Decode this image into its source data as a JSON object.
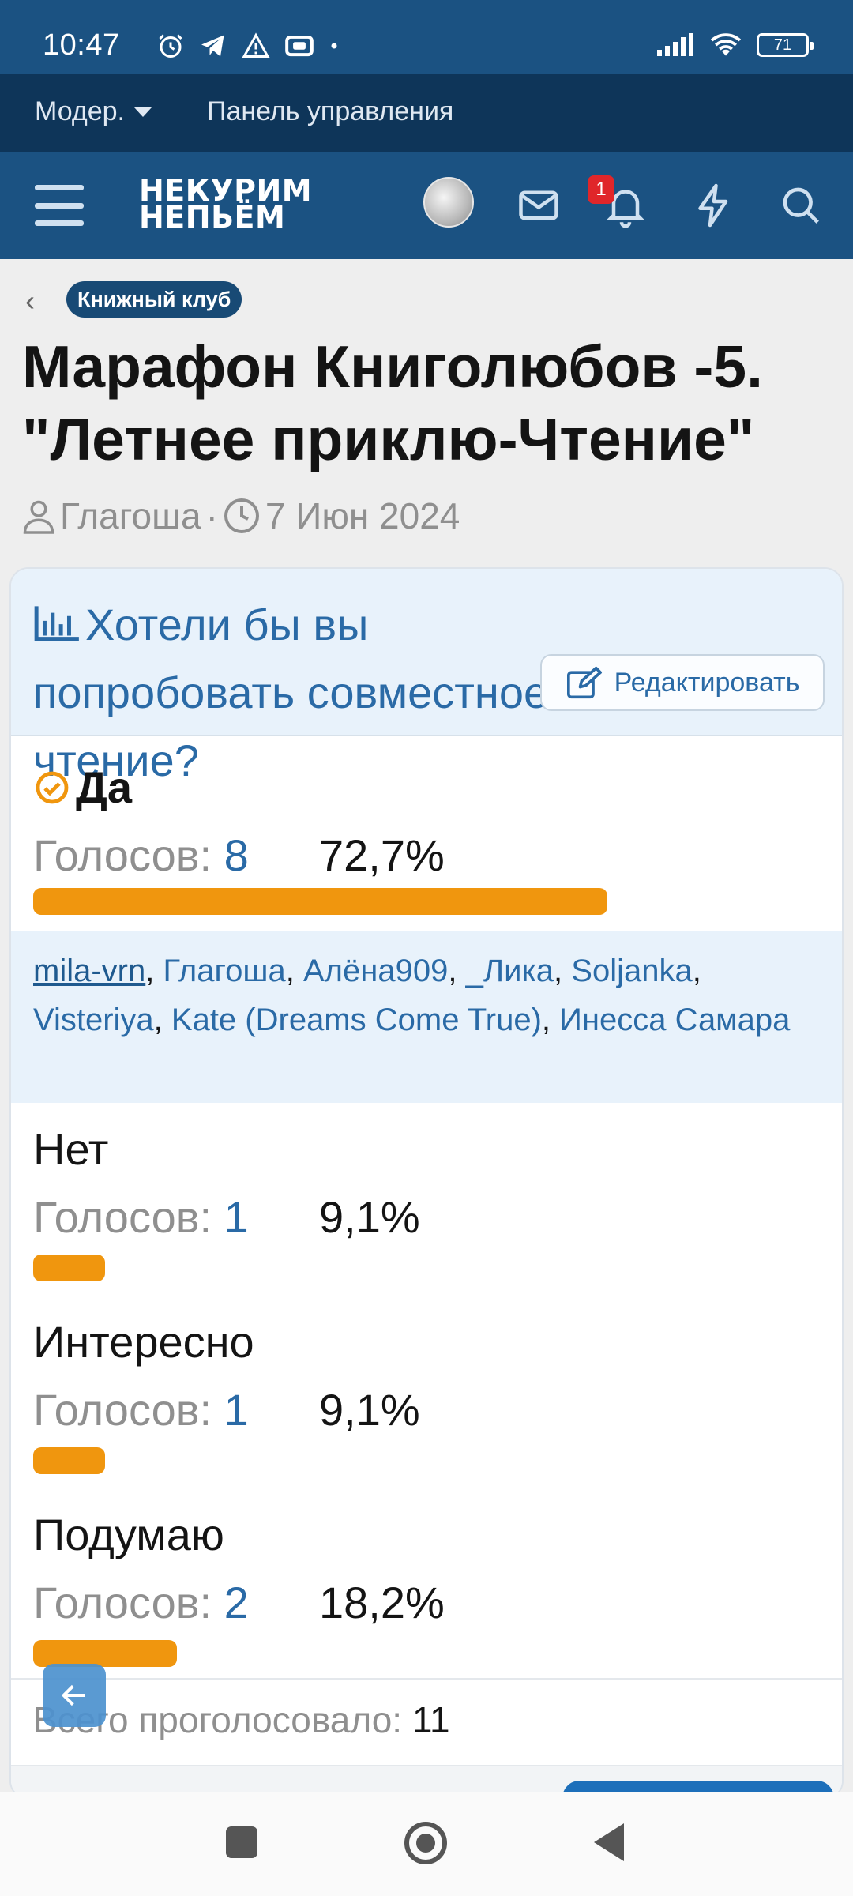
{
  "status_bar": {
    "time": "10:47",
    "icons_left": [
      "alarm-icon",
      "telegram-icon",
      "warning-icon",
      "cast-icon",
      "dot-icon"
    ],
    "icons_right": [
      "signal-icon",
      "wifi-icon",
      "battery-icon"
    ],
    "battery": "71"
  },
  "mod_bar": {
    "moderator_label": "Модер.",
    "control_panel_label": "Панель управления"
  },
  "header": {
    "logo_line1": "НЕКУРИМ",
    "logo_line2": "НЕПЬЁМ",
    "notification_count": "1",
    "icons": [
      "menu-icon",
      "avatar",
      "mail-icon",
      "bell-icon",
      "lightning-icon",
      "search-icon"
    ]
  },
  "breadcrumb": {
    "back": "‹",
    "forum": "Книжный клуб"
  },
  "thread": {
    "title": "Марафон Книголюбов -5. \"Летнее приклю-Чтение\"",
    "author": "Глагоша",
    "separator": "·",
    "date": "7 Июн 2024"
  },
  "poll": {
    "question": "Хотели бы вы попробовать совместное чтение?",
    "edit_label": "Редактировать",
    "votes_label": "Голосов:",
    "options": [
      {
        "label": "Да",
        "votes": "8",
        "percent": "72,7%",
        "fraction": 0.727,
        "voted": true
      },
      {
        "label": "Нет",
        "votes": "1",
        "percent": "9,1%",
        "fraction": 0.091,
        "voted": false
      },
      {
        "label": "Интересно",
        "votes": "1",
        "percent": "9,1%",
        "fraction": 0.091,
        "voted": false
      },
      {
        "label": "Подумаю",
        "votes": "2",
        "percent": "18,2%",
        "fraction": 0.182,
        "voted": false
      }
    ],
    "voters": [
      "mila-vrn",
      "Глагоша",
      "Алёна909",
      "_Лика",
      "Soljanka",
      "Visteriya",
      "Kate (Dreams Come True)",
      "Инесса Самара"
    ],
    "total_label": "Всего проголосовало:",
    "total": "11"
  },
  "colors": {
    "header_bg": "#1b5282",
    "mod_bar_bg": "#0e3559",
    "accent_blue": "#2a6aa6",
    "bar_orange": "#f0960e",
    "poll_head_bg": "#e8f2fb"
  }
}
